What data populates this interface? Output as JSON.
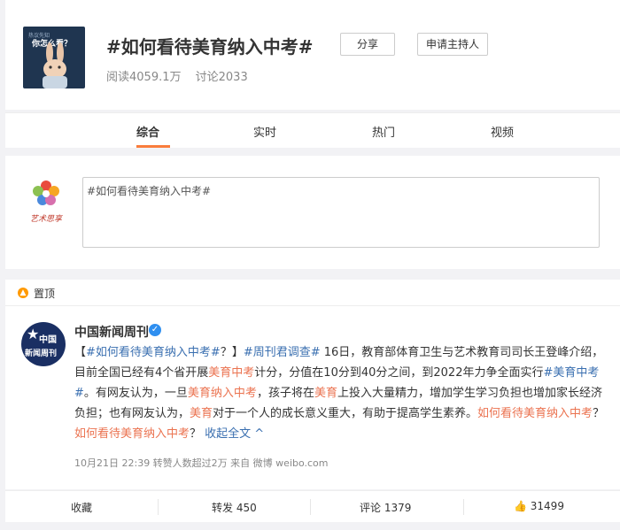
{
  "topic": {
    "title": "#如何看待美育纳入中考#",
    "read_label": "阅读4059.1万",
    "discuss_label": "讨论2033",
    "share_label": "分享",
    "apply_host_label": "申请主持人",
    "cover_caption": "你怎么看？",
    "cover_tag": "热议先知"
  },
  "tabs": [
    {
      "label": "综合",
      "active": true
    },
    {
      "label": "实时",
      "active": false
    },
    {
      "label": "热门",
      "active": false
    },
    {
      "label": "视频",
      "active": false
    }
  ],
  "composer": {
    "text": "#如何看待美育纳入中考#",
    "logo_text": "艺术思享"
  },
  "pinned": {
    "label": "置顶"
  },
  "post": {
    "author": "中国新闻周刊",
    "avatar_line1": "中国",
    "avatar_line2": "新闻周刊",
    "verified_icon": "verified-badge-icon",
    "body": {
      "p1": "【",
      "tag1": "#如何看待美育纳入中考#",
      "p2": "？】",
      "tag2": "#周刊君调查#",
      "p3": " 16日，教育部体育卫生与艺术教育司司长王登峰介绍，目前全国已经有4个省开展",
      "kw1": "美育中考",
      "p4": "计分，分值在10分到40分之间，到2022年力争全面实行",
      "tag3": "#美育中考#",
      "p5": "。有网友认为，一旦",
      "kw2": "美育纳入中考",
      "p6": "，孩子将在",
      "kw3": "美育",
      "p7": "上投入大量精力，增加学生学习负担也增加家长经济负担；也有网友认为，",
      "kw4": "美育",
      "p8": "对于一个人的成长意义重大，有助于提高学生素养。",
      "link1": "如何看待美育纳入中考",
      "p9": "？ ",
      "link2": "如何看待美育纳入中考",
      "p10": "？ ",
      "collapse": "收起全文"
    },
    "meta": "10月21日 22:39 转赞人数超过2万 来自 微博 weibo.com"
  },
  "actions": {
    "favorite": "收藏",
    "repost": "转发 450",
    "comment": "评论 1379",
    "like": "31499"
  },
  "colors": {
    "accent": "#fa7d3c",
    "tag": "#eb7350",
    "link": "#3a6fb0"
  }
}
